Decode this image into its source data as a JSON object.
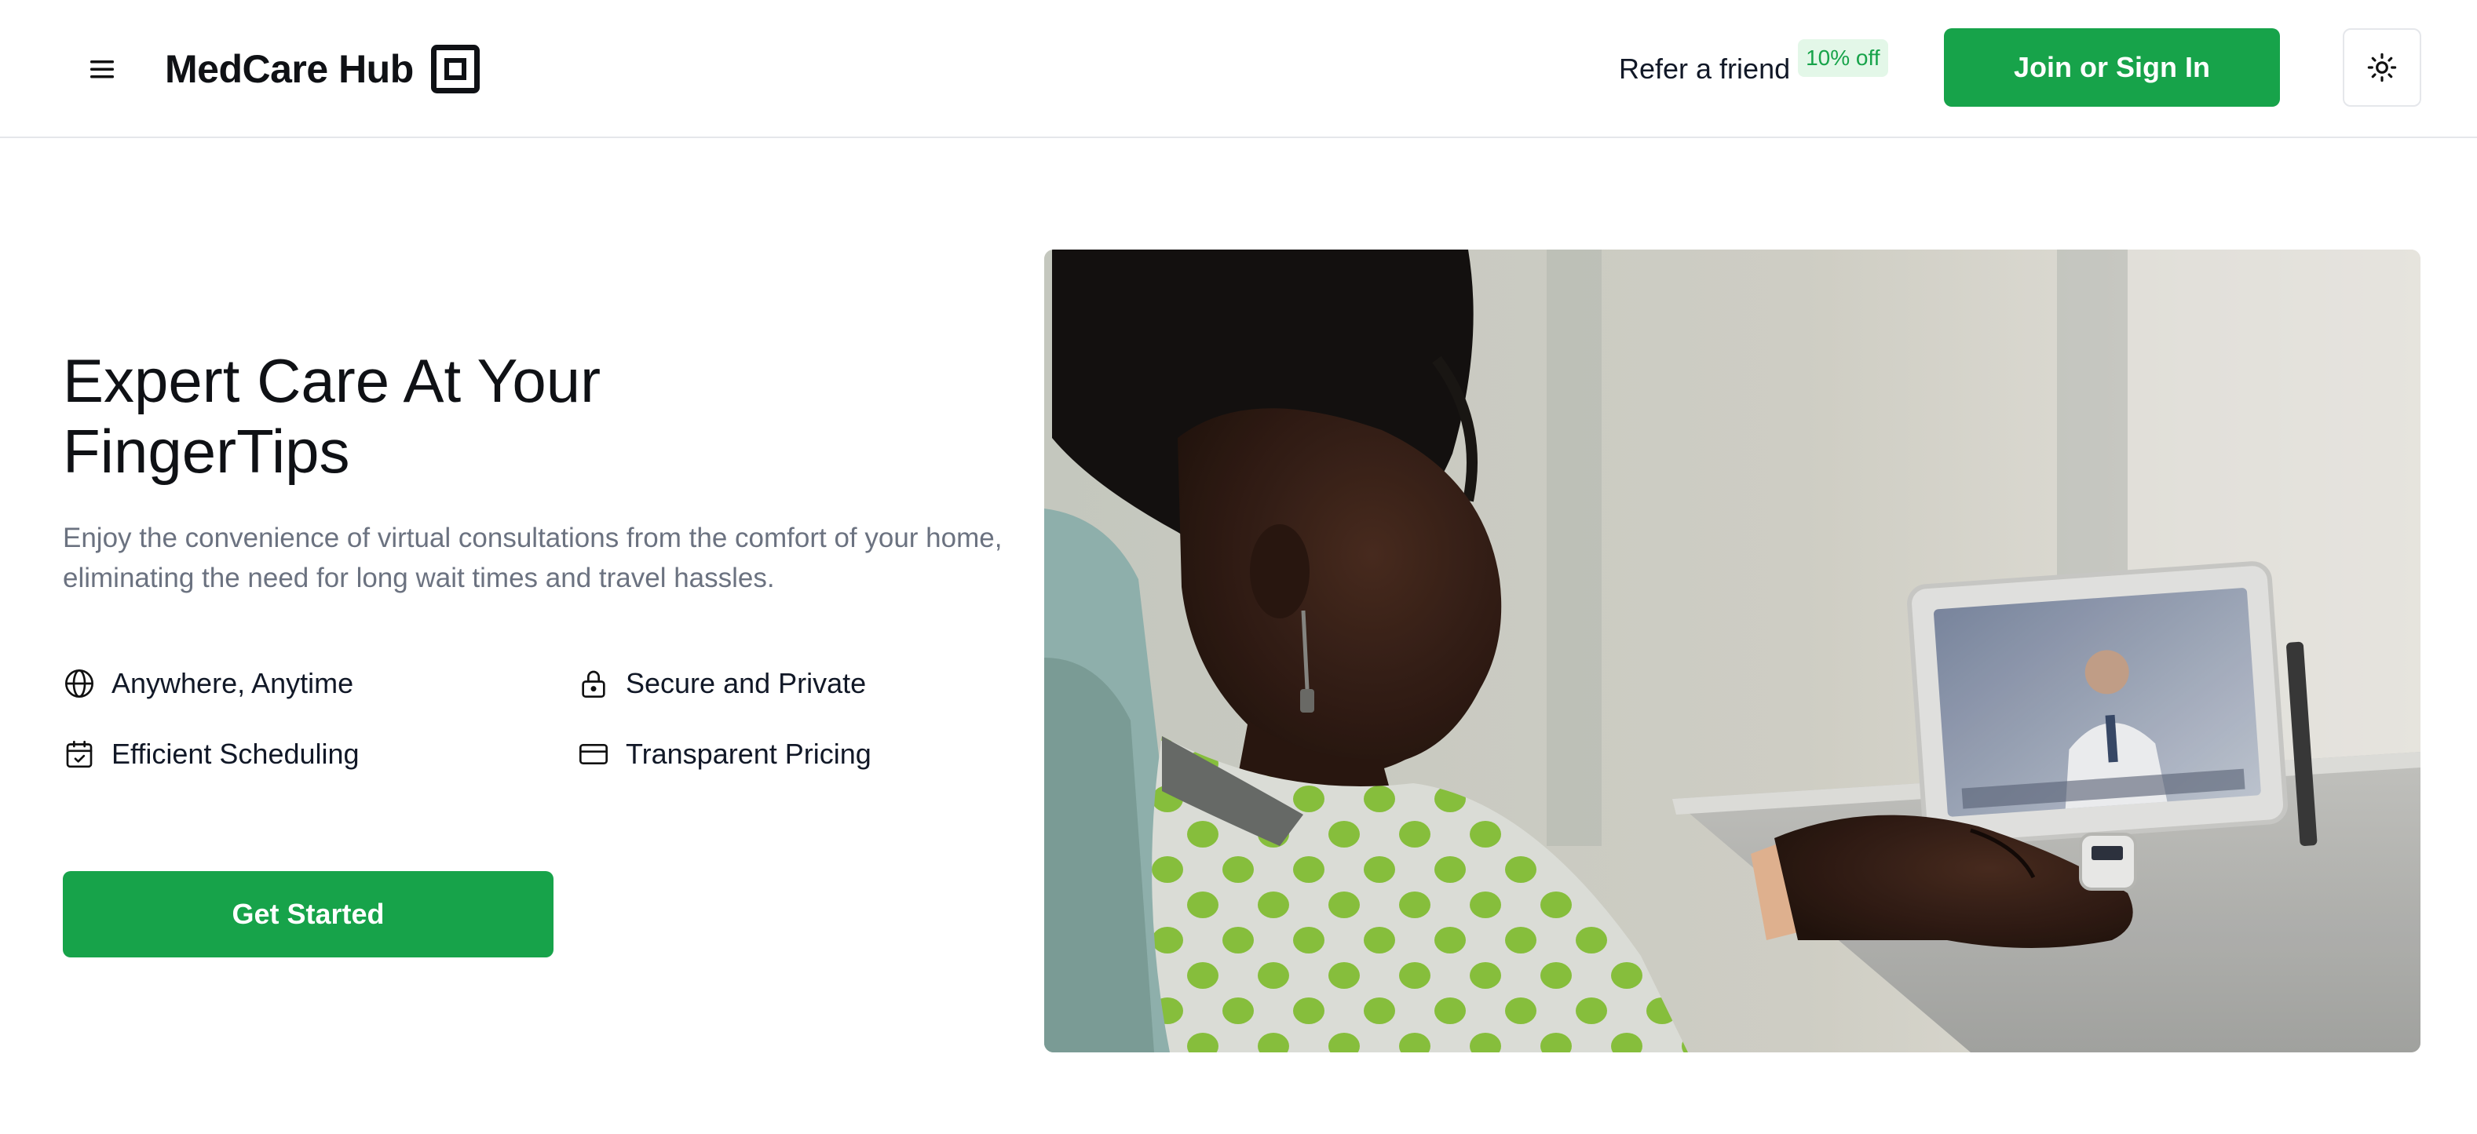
{
  "header": {
    "menu_icon": "hamburger-menu-icon",
    "brand_name": "MedCare Hub",
    "brand_logo_icon": "square-logo-icon",
    "refer_label": "Refer a friend",
    "refer_badge": "10% off",
    "join_label": "Join or Sign In",
    "theme_icon": "sun-icon"
  },
  "hero": {
    "title_line1": "Expert Care At Your",
    "title_line2": "FingerTips",
    "description": "Enjoy the convenience of virtual consultations from the comfort of your home, eliminating the need for long wait times and travel hassles.",
    "features": [
      {
        "label": "Anywhere, Anytime",
        "icon": "globe-icon"
      },
      {
        "label": "Secure and Private",
        "icon": "lock-icon"
      },
      {
        "label": "Efficient Scheduling",
        "icon": "calendar-check-icon"
      },
      {
        "label": "Transparent Pricing",
        "icon": "credit-card-icon"
      }
    ],
    "cta_label": "Get Started"
  },
  "colors": {
    "accent": "#17a34a",
    "badge_bg": "#e3f7e8",
    "muted_text": "#6b7280",
    "border": "#e5e7eb"
  }
}
